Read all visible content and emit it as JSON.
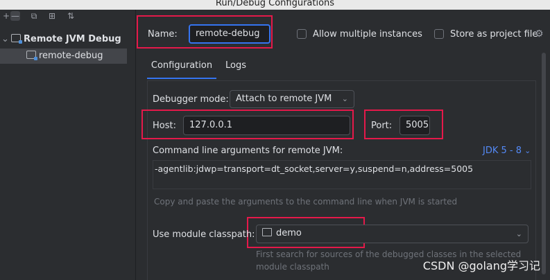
{
  "window": {
    "title": "Run/Debug Configurations"
  },
  "toolbar": {
    "icons": [
      "add-icon",
      "remove-icon",
      "copy-icon",
      "folder-add-icon",
      "sort-icon"
    ]
  },
  "tree": {
    "group_label": "Remote JVM Debug",
    "item_label": "remote-debug"
  },
  "form": {
    "name_label": "Name:",
    "name_value": "remote-debug",
    "allow_multiple_label": "Allow multiple instances",
    "store_project_label": "Store as project file",
    "tabs": [
      {
        "label": "Configuration"
      },
      {
        "label": "Logs"
      }
    ],
    "debugger_mode_label": "Debugger mode:",
    "debugger_mode_value": "Attach to remote JVM",
    "host_label": "Host:",
    "host_value": "127.0.0.1",
    "port_label": "Port:",
    "port_value": "5005",
    "cmd_label": "Command line arguments for remote JVM:",
    "jdk_label": "JDK 5 - 8",
    "cmd_value": "-agentlib:jdwp=transport=dt_socket,server=y,suspend=n,address=5005",
    "cmd_hint": "Copy and paste the arguments to the command line when JVM is started",
    "module_label": "Use module classpath:",
    "module_value": "demo",
    "module_hint_1": "First search for sources of the debugged classes in the selected",
    "module_hint_2": "module classpath"
  },
  "watermark": "CSDN @golang学习记",
  "colors": {
    "accent": "#3574f0",
    "highlight": "#e5194a",
    "link": "#548af7"
  }
}
